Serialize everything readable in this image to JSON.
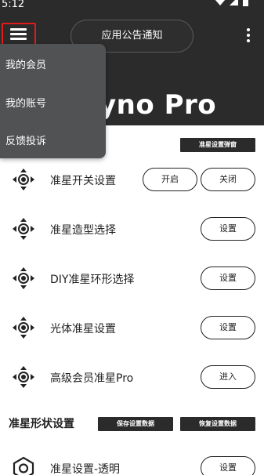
{
  "status_bar": {
    "time": "5:12",
    "icons": [
      "wifi-icon",
      "signal-icon",
      "battery-icon"
    ]
  },
  "header": {
    "notice_label": "应用公告通知",
    "brand_fragment": "yno Pro"
  },
  "dropdown": {
    "items": [
      {
        "label": "我的会员"
      },
      {
        "label": "我的账号"
      },
      {
        "label": "反馈投诉"
      }
    ]
  },
  "popup_button_label": "准星设置弹窗",
  "settings": {
    "rows": [
      {
        "label": "准星开关设置",
        "on_label": "开启",
        "off_label": "关闭"
      },
      {
        "label": "准星造型选择",
        "button_label": "设置"
      },
      {
        "label": "DIY准星环形选择",
        "button_label": "设置"
      },
      {
        "label": "光体准星设置",
        "button_label": "设置"
      },
      {
        "label": "高级会员准星Pro",
        "button_label": "进入"
      }
    ]
  },
  "shape_section": {
    "title": "准星形状设置",
    "save_label": "保存设置数据",
    "restore_label": "恢复设置数据",
    "rows": [
      {
        "label": "准星设置-透明",
        "button_label": "设置"
      }
    ]
  },
  "colors": {
    "header_bg": "#2b2b2b",
    "menu_bg": "#505254",
    "highlight_border": "#e11b1b"
  }
}
